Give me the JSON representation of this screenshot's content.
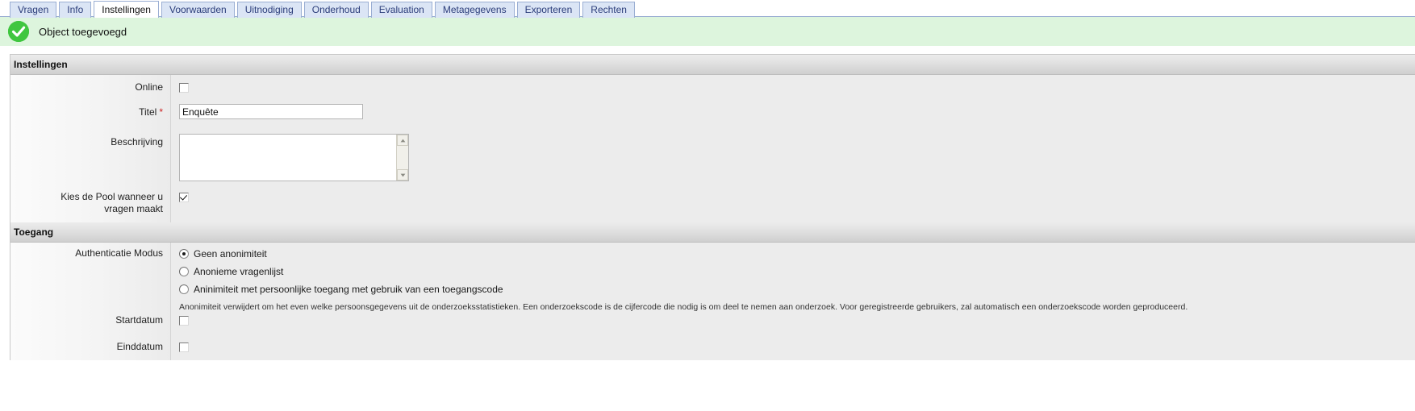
{
  "tabs": [
    {
      "label": "Vragen",
      "active": false
    },
    {
      "label": "Info",
      "active": false
    },
    {
      "label": "Instellingen",
      "active": true
    },
    {
      "label": "Voorwaarden",
      "active": false
    },
    {
      "label": "Uitnodiging",
      "active": false
    },
    {
      "label": "Onderhoud",
      "active": false
    },
    {
      "label": "Evaluation",
      "active": false
    },
    {
      "label": "Metagegevens",
      "active": false
    },
    {
      "label": "Exporteren",
      "active": false
    },
    {
      "label": "Rechten",
      "active": false
    }
  ],
  "message": {
    "icon": "success-check-icon",
    "text": "Object toegevoegd",
    "background": "#ddf5dd",
    "icon_color": "#3fc63f"
  },
  "settings_section": {
    "title": "Instellingen",
    "online": {
      "label": "Online",
      "checked": false
    },
    "titel": {
      "label": "Titel",
      "required_marker": "*",
      "value": "Enquête",
      "placeholder": ""
    },
    "beschrijving": {
      "label": "Beschrijving",
      "value": "",
      "placeholder": ""
    },
    "pool": {
      "label_line1": "Kies de Pool wanneer u",
      "label_line2": "vragen maakt",
      "checked": true
    }
  },
  "access_section": {
    "title": "Toegang",
    "auth_mode": {
      "label": "Authenticatie Modus",
      "options": [
        {
          "label": "Geen anonimiteit",
          "selected": true
        },
        {
          "label": "Anonieme vragenlijst",
          "selected": false
        },
        {
          "label": "Aninimiteit met persoonlijke toegang met gebruik van een toegangscode",
          "selected": false
        }
      ],
      "help": "Anonimiteit verwijdert om het even welke persoonsgegevens uit de onderzoeksstatistieken. Een onderzoekscode is de cijfercode die nodig is om deel te nemen aan onderzoek. Voor geregistreerde gebruikers, zal automatisch een onderzoekscode worden geproduceerd."
    },
    "startdatum": {
      "label": "Startdatum",
      "checked": false
    },
    "einddatum": {
      "label": "Einddatum",
      "checked": false
    }
  },
  "colors": {
    "tab_inactive_bg": "#dbe5f5",
    "tab_border": "#9aaed3",
    "tab_text": "#2b3d7a",
    "panel_bg": "#ececec",
    "required_red": "#cc2222"
  }
}
